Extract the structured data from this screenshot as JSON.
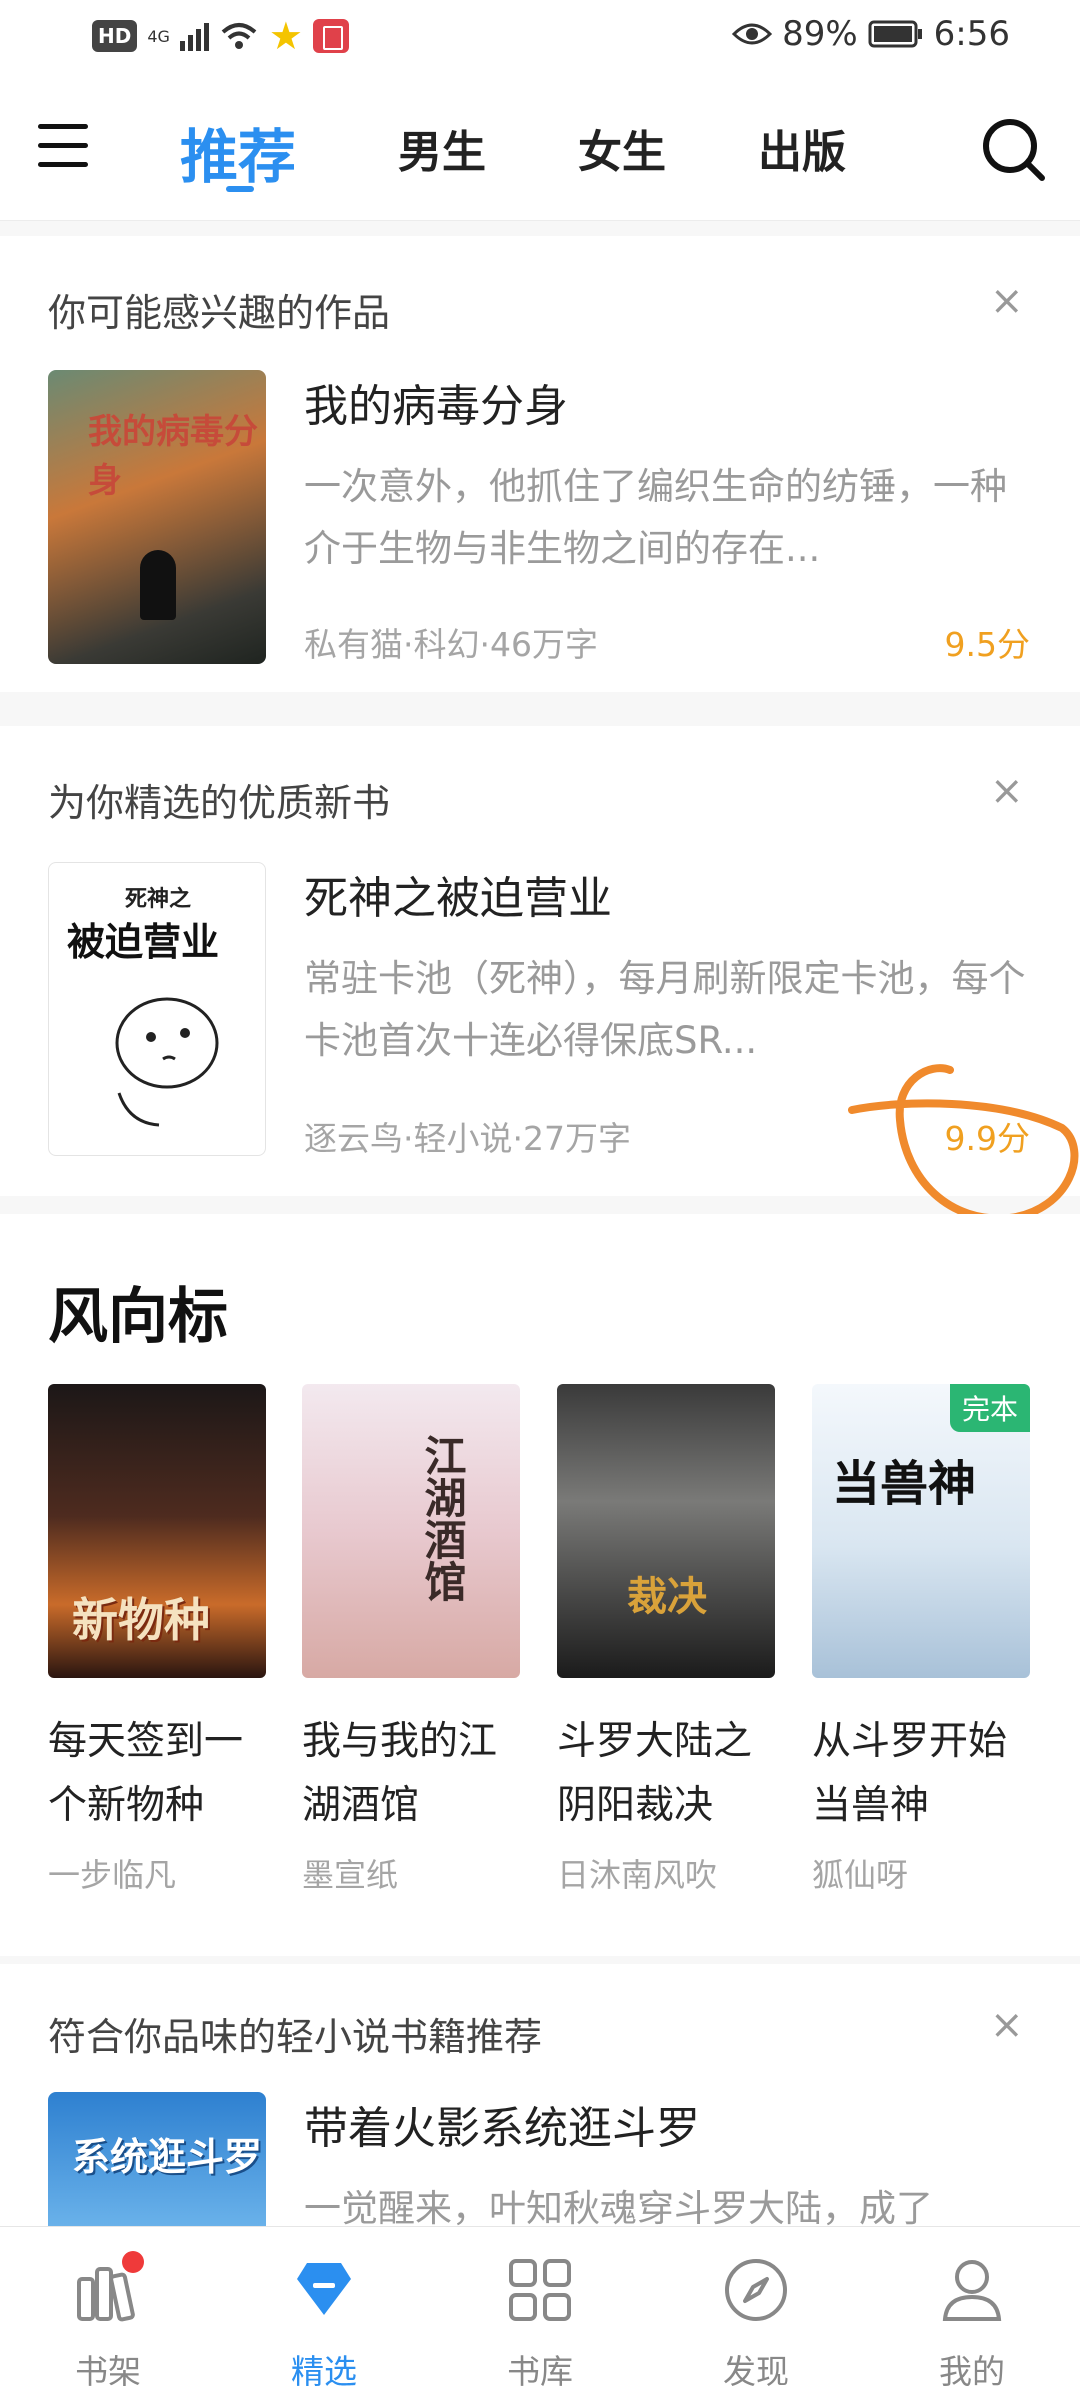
{
  "status_bar": {
    "hd": "HD",
    "network": "4G",
    "battery": "89%",
    "time": "6:56"
  },
  "nav": {
    "tabs": [
      {
        "label": "推荐",
        "active": true
      },
      {
        "label": "男生"
      },
      {
        "label": "女生"
      },
      {
        "label": "出版"
      }
    ]
  },
  "sections": [
    {
      "title": "你可能感兴趣的作品",
      "book": {
        "title": "我的病毒分身",
        "desc": "一次意外，他抓住了编织生命的纺锤，一种介于生物与非生物之间的存在...",
        "meta": "私有猫·科幻·46万字",
        "score": "9.5分",
        "cover_text": "我的病毒分身"
      }
    },
    {
      "title": "为你精选的优质新书",
      "book": {
        "title": "死神之被迫营业",
        "desc": "常驻卡池（死神），每月刷新限定卡池，每个卡池首次十连必得保底SR...",
        "meta": "逐云鸟·轻小说·27万字",
        "score": "9.9分",
        "cover_text": "被迫营业",
        "cover_top": "死神之"
      }
    }
  ],
  "wind": {
    "title": "风向标",
    "books": [
      {
        "title": "每天签到一个新物种",
        "author": "一步临凡",
        "cover_text": "新物种"
      },
      {
        "title": "我与我的江湖酒馆",
        "author": "墨宣纸",
        "cover_text": "江湖酒馆"
      },
      {
        "title": "斗罗大陆之阴阳裁决",
        "author": "日沐南风吹",
        "cover_text": "裁决"
      },
      {
        "title": "从斗罗开始当兽神",
        "author": "狐仙呀",
        "cover_text": "当兽神",
        "badge": "完本"
      }
    ]
  },
  "section3": {
    "title": "符合你品味的轻小说书籍推荐",
    "book": {
      "title": "带着火影系统逛斗罗",
      "desc": "一觉醒来，叶知秋魂穿斗罗大陆，成了",
      "cover_text": "系统逛斗罗"
    }
  },
  "bottom_nav": [
    {
      "label": "书架",
      "icon": "bookshelf-icon"
    },
    {
      "label": "精选",
      "icon": "diamond-icon",
      "active": true
    },
    {
      "label": "书库",
      "icon": "grid-icon"
    },
    {
      "label": "发现",
      "icon": "compass-icon"
    },
    {
      "label": "我的",
      "icon": "person-icon"
    }
  ],
  "close_glyph": "×",
  "colors": {
    "accent": "#2b8ff0",
    "score": "#f0a020",
    "annotation": "#f08a2c"
  }
}
